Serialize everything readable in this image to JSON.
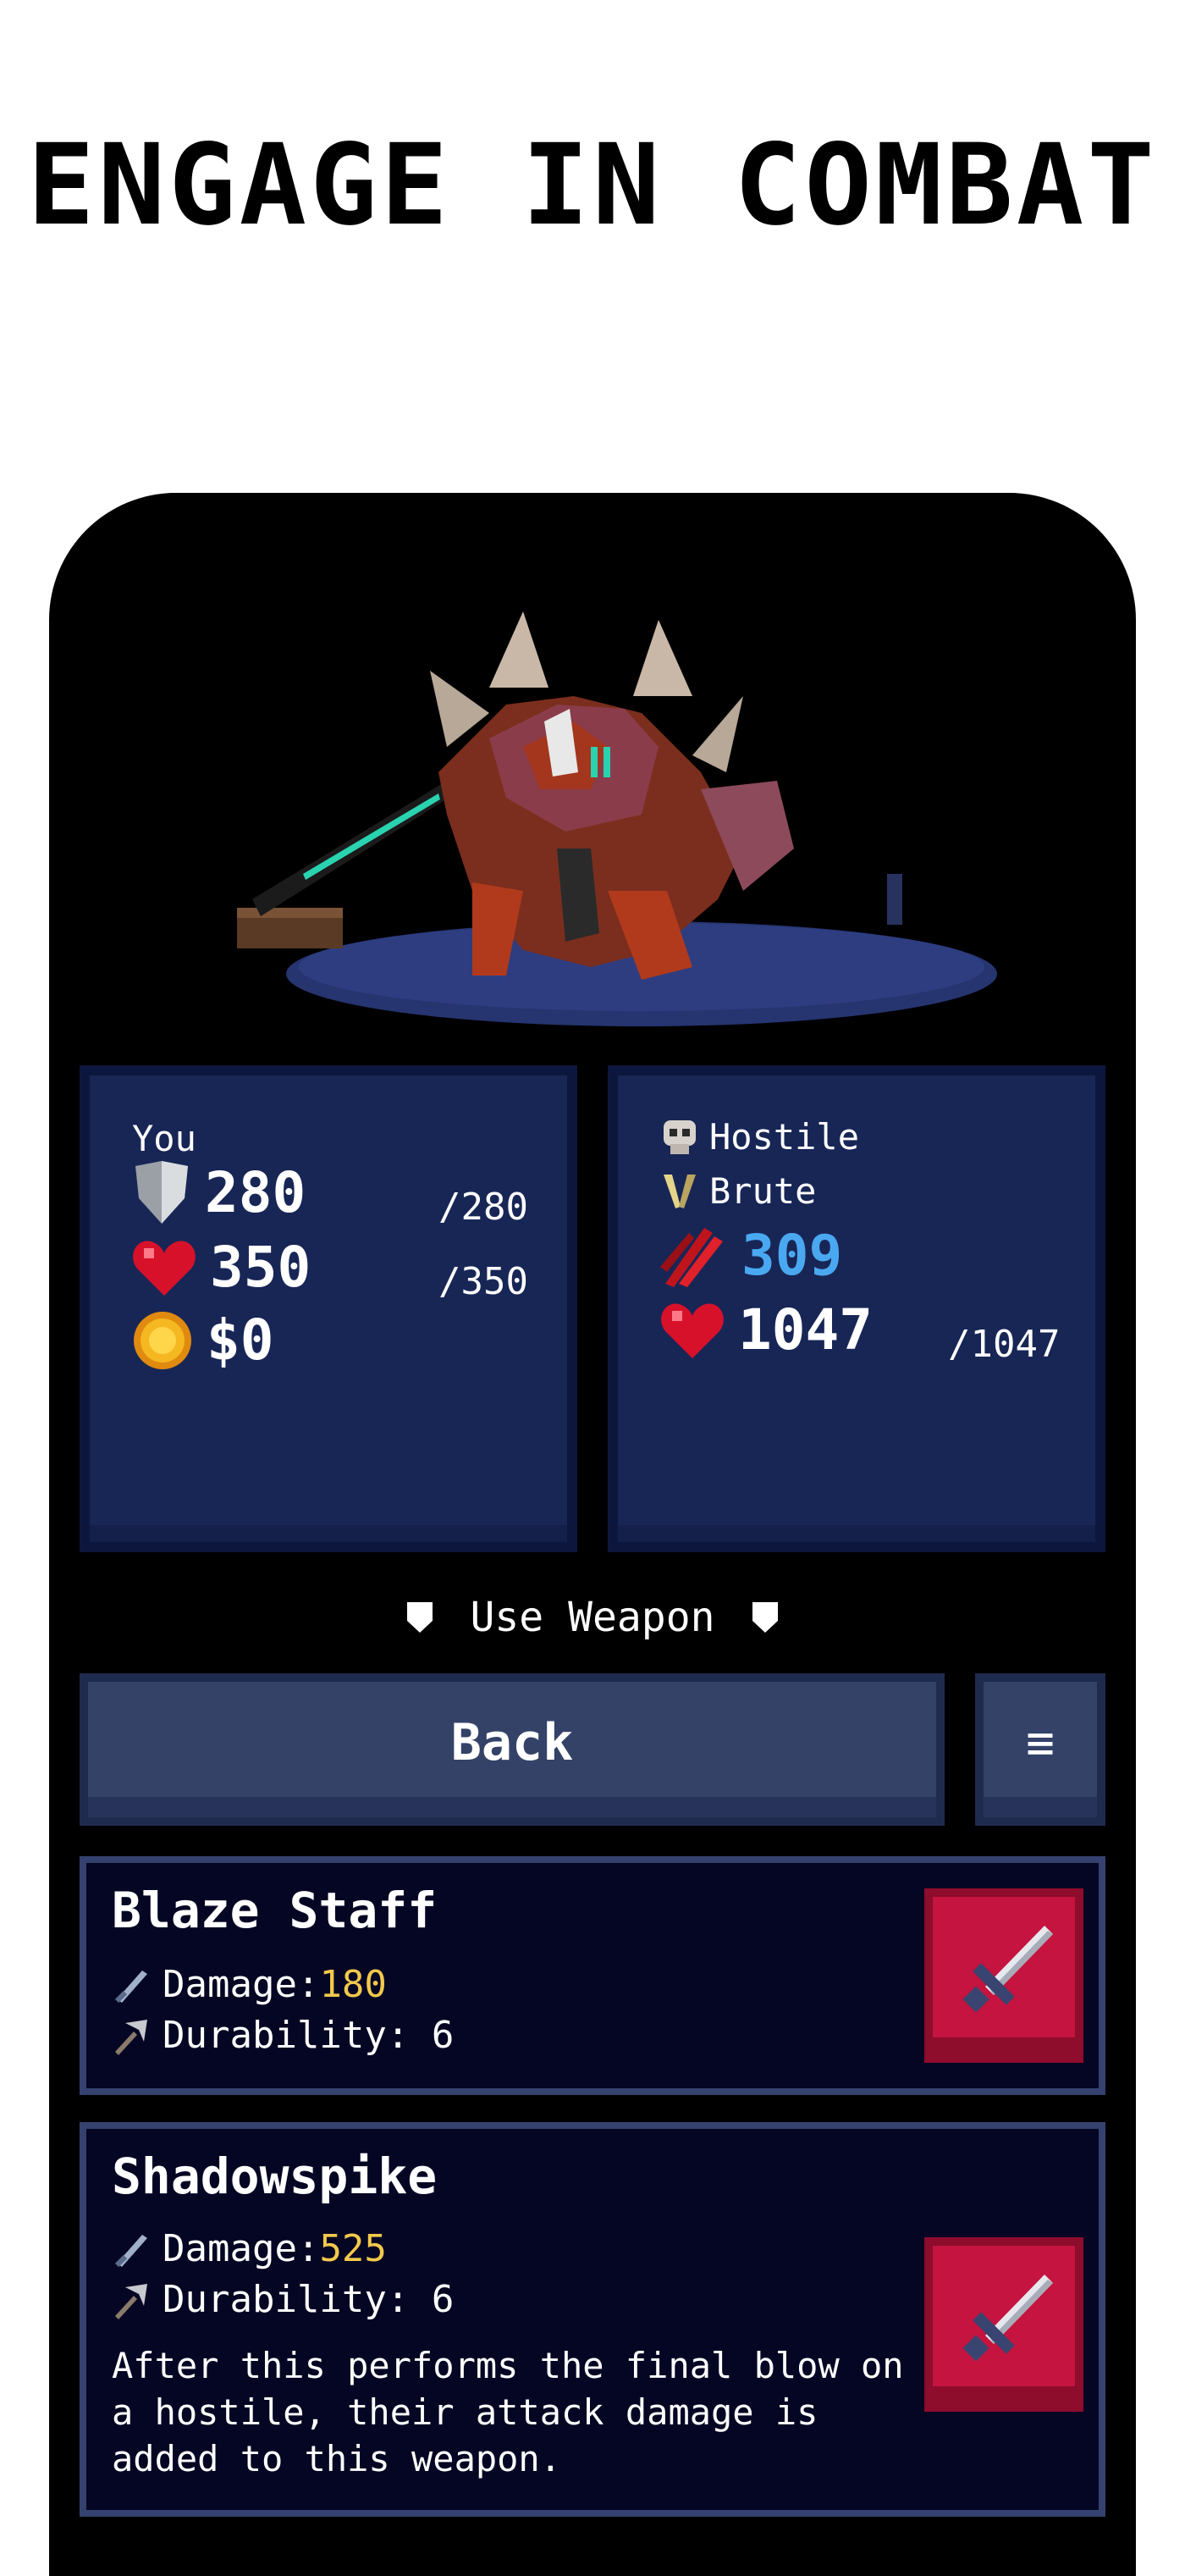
{
  "headline": "ENGAGE IN COMBAT",
  "player": {
    "label": "You",
    "armor": "280",
    "armor_max": "/280",
    "health": "350",
    "health_max": "/350",
    "gold": "$0"
  },
  "enemy": {
    "disposition": "Hostile",
    "class": "Brute",
    "attack": "309",
    "health": "1047",
    "health_max": "/1047",
    "colors": {
      "attack": "#4aa8f0"
    }
  },
  "action": {
    "use_weapon": "Use Weapon"
  },
  "buttons": {
    "back": "Back",
    "menu_icon": "≡"
  },
  "weapons": [
    {
      "name": "Blaze Staff",
      "damage_label": "Damage: ",
      "damage": "180",
      "durability_label": "Durability: 6",
      "description": ""
    },
    {
      "name": "Shadowspike",
      "damage_label": "Damage: ",
      "damage": "525",
      "durability_label": "Durability: 6",
      "description": "After this performs the final blow on a hostile, their attack damage is added to this weapon."
    }
  ],
  "icons": [
    "shield-icon",
    "heart-icon",
    "coin-icon",
    "skull-icon",
    "horns-icon",
    "claw-icon",
    "sword-icon",
    "pickaxe-icon",
    "sword-tile-icon",
    "menu-icon"
  ]
}
